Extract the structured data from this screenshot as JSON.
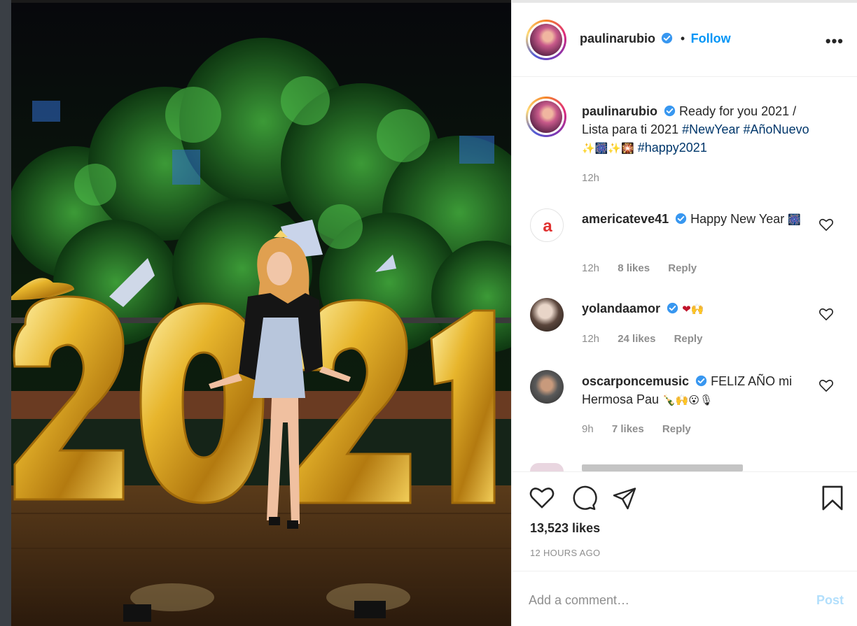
{
  "post": {
    "username": "paulinarubio",
    "follow_label": "Follow",
    "separator": "•",
    "more_label": "•••"
  },
  "caption": {
    "username": "paulinarubio",
    "text": "Ready for you 2021 / Lista para ti 2021",
    "tags": [
      "#NewYear",
      "#AñoNuevo",
      "#happy2021"
    ],
    "emoji": "✨🎆✨🎇",
    "time": "12h"
  },
  "comments": [
    {
      "username": "americateve41",
      "text": "Happy New Year",
      "emoji": "🎆",
      "time": "12h",
      "likes": "8 likes",
      "reply": "Reply"
    },
    {
      "username": "yolandaamor",
      "text": "",
      "emoji": "❤🙌",
      "time": "12h",
      "likes": "24 likes",
      "reply": "Reply"
    },
    {
      "username": "oscarponcemusic",
      "text": "FELIZ AÑO mi Hermosa Pau",
      "emoji": "🍾🙌😮🎙",
      "time": "9h",
      "likes": "7 likes",
      "reply": "Reply"
    }
  ],
  "footer": {
    "likes": "13,523 likes",
    "timestamp": "12 HOURS AGO",
    "comment_placeholder": "Add a comment…",
    "post_label": "Post"
  },
  "icons": [
    "verified-badge-icon",
    "heart-icon",
    "comment-icon",
    "share-icon",
    "bookmark-icon",
    "more-options-icon"
  ],
  "colors": {
    "link": "#0095f6",
    "verified": "#3897f0",
    "muted": "#8e8e8e",
    "post_disabled": "#b2dffc"
  }
}
